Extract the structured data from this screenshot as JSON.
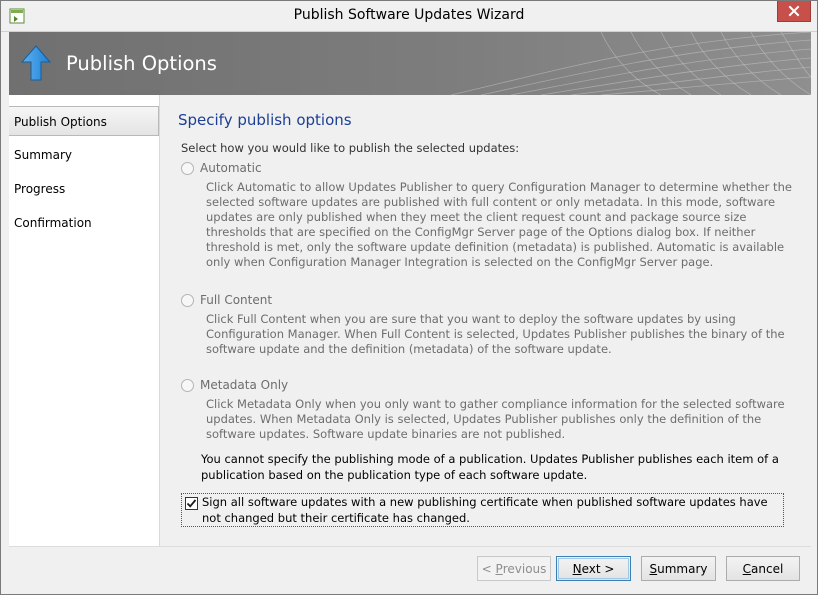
{
  "window": {
    "title": "Publish Software Updates Wizard"
  },
  "banner": {
    "title": "Publish Options",
    "icon": "up-arrow-icon"
  },
  "nav": {
    "items": [
      {
        "label": "Publish Options",
        "active": true
      },
      {
        "label": "Summary",
        "active": false
      },
      {
        "label": "Progress",
        "active": false
      },
      {
        "label": "Confirmation",
        "active": false
      }
    ]
  },
  "content": {
    "heading": "Specify publish options",
    "intro": "Select how you would like to publish the selected updates:",
    "options": [
      {
        "label": "Automatic",
        "selected": false,
        "enabled": false,
        "description": "Click Automatic to allow Updates Publisher to query  Configuration Manager to determine whether the selected software updates are published with full content or only metadata. In this mode, software updates are only published when they meet the client request count and package source size thresholds that are specified on the ConfigMgr Server page of the Options dialog box. If neither threshold is met, only the software update definition (metadata) is published. Automatic is available only when Configuration Manager Integration is selected on the ConfigMgr Server page."
      },
      {
        "label": "Full Content",
        "selected": false,
        "enabled": false,
        "description": "Click Full Content when you are sure that you want to deploy the software updates by using Configuration Manager. When Full Content is selected, Updates Publisher publishes the binary of the software update and the definition (metadata) of the software update."
      },
      {
        "label": "Metadata Only",
        "selected": false,
        "enabled": false,
        "description": "Click Metadata Only when you only want to gather compliance information for the selected software updates. When Metadata Only is selected, Updates Publisher publishes only the definition of the software updates. Software update binaries are not published."
      }
    ],
    "note": "You cannot specify the publishing mode of a publication. Updates Publisher publishes each item of a publication based on the publication type of each software update.",
    "sign_checkbox": {
      "label": "Sign all software updates with a new publishing certificate when published software updates have not changed but their certificate has changed.",
      "checked": true
    }
  },
  "buttons": {
    "previous": {
      "label_prefix": "< ",
      "label_accel": "P",
      "label_rest": "revious",
      "enabled": false
    },
    "next": {
      "label_accel": "N",
      "label_rest": "ext >",
      "enabled": true
    },
    "summary": {
      "label_accel": "S",
      "label_rest": "ummary",
      "enabled": true
    },
    "cancel": {
      "label_accel": "C",
      "label_rest": "ancel",
      "enabled": true
    }
  },
  "colors": {
    "heading": "#1c3f94",
    "banner_bg": "#7d7d7d",
    "close_button": "#c7504b",
    "disabled_text": "#6d6d6d"
  }
}
